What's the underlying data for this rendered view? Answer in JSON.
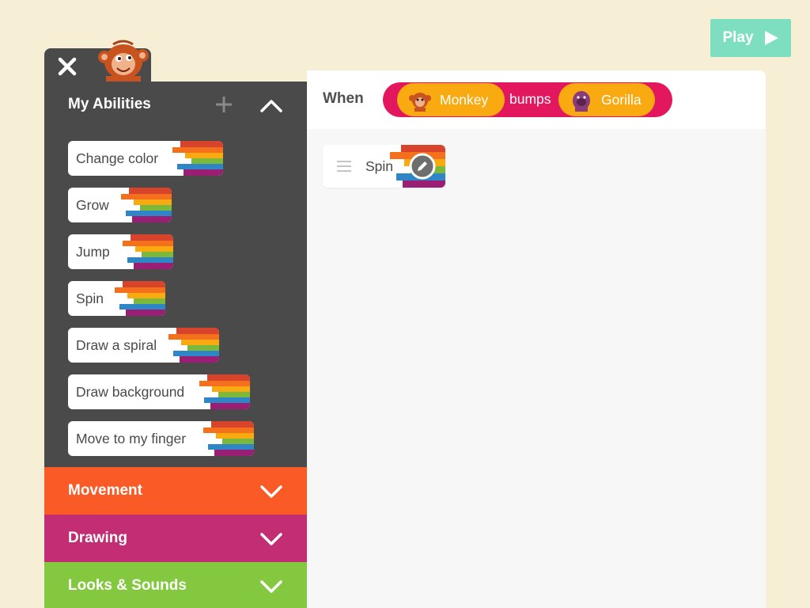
{
  "play": {
    "label": "Play",
    "icon": "play-triangle-icon"
  },
  "tab": {
    "close_icon": "close-icon",
    "character_icon": "monkey-icon"
  },
  "abilities": {
    "title": "My Abilities",
    "add_icon": "plus-icon",
    "collapse_icon": "chevron-up-icon",
    "items": [
      {
        "label": "Change color"
      },
      {
        "label": "Grow"
      },
      {
        "label": "Jump"
      },
      {
        "label": "Spin"
      },
      {
        "label": "Draw a spiral"
      },
      {
        "label": "Draw background"
      },
      {
        "label": "Move to my finger"
      }
    ]
  },
  "categories": [
    {
      "label": "Movement",
      "color": "#f95a26"
    },
    {
      "label": "Drawing",
      "color": "#c22d74"
    },
    {
      "label": "Looks & Sounds",
      "color": "#83c83e"
    }
  ],
  "rule": {
    "when_label": "When",
    "actor1": "Monkey",
    "verb": "bumps",
    "actor2": "Gorilla"
  },
  "script_blocks": [
    {
      "label": "Spin",
      "edit_icon": "pencil-icon"
    }
  ],
  "colors": {
    "background": "#f6efd6",
    "sidebar": "#4a4a4a",
    "play_button": "#7ddfbf",
    "trigger_pill": "#e2175e",
    "actor_pill": "#f9aa10",
    "rainbow": [
      "#d8432b",
      "#f5701c",
      "#f9aa10",
      "#7cb83a",
      "#2f86c6",
      "#9a1f74"
    ]
  }
}
